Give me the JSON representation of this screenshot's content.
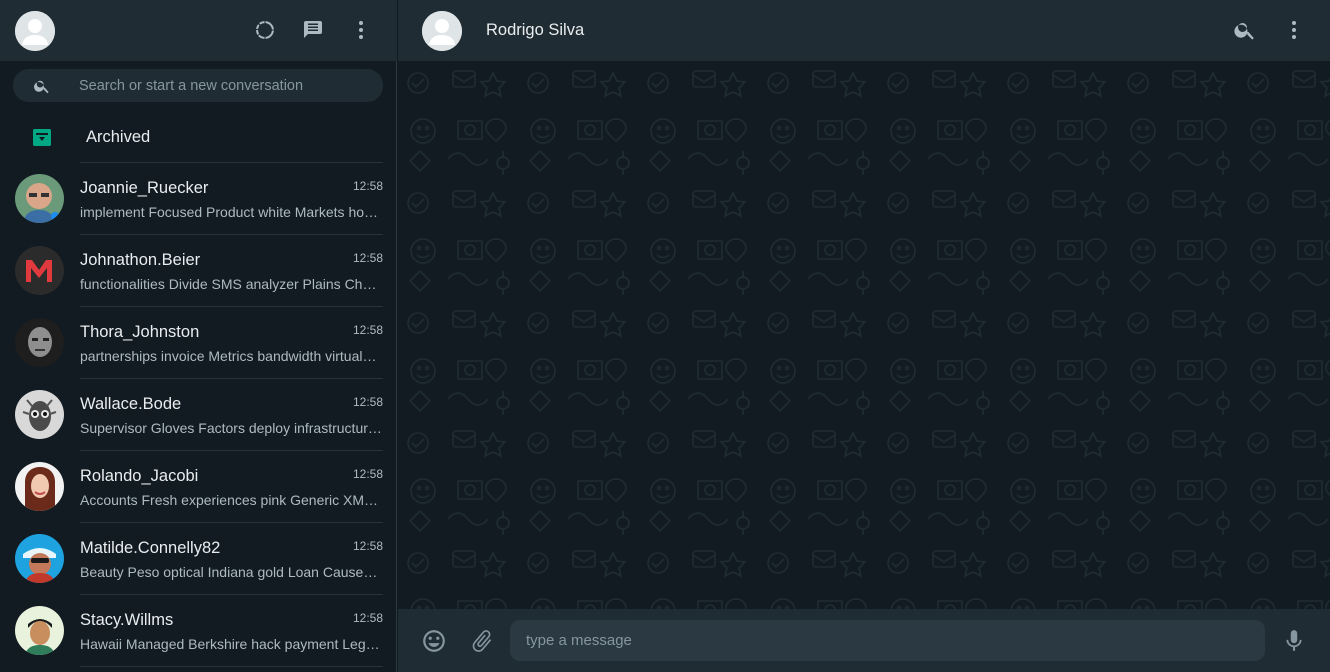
{
  "sidebar": {
    "header": {
      "avatar_icon": "user-silhouette-icon",
      "icons": [
        "status-icon",
        "new-chat-icon",
        "menu-dots-icon"
      ]
    },
    "search": {
      "placeholder": "Search or start a new conversation",
      "icon": "search-icon"
    },
    "archived": {
      "label": "Archived",
      "icon": "archive-icon",
      "icon_color": "#00a884"
    },
    "chats": [
      {
        "name": "Joannie_Ruecker",
        "time": "12:58",
        "message": "implement Focused Product white Markets hos…"
      },
      {
        "name": "Johnathon.Beier",
        "time": "12:58",
        "message": "functionalities Divide SMS analyzer Plains Che…"
      },
      {
        "name": "Thora_Johnston",
        "time": "12:58",
        "message": "partnerships invoice Metrics bandwidth virtual…"
      },
      {
        "name": "Wallace.Bode",
        "time": "12:58",
        "message": "Supervisor Gloves Factors deploy infrastructur…"
      },
      {
        "name": "Rolando_Jacobi",
        "time": "12:58",
        "message": "Accounts Fresh experiences pink Generic XML…"
      },
      {
        "name": "Matilde.Connelly82",
        "time": "12:58",
        "message": "Beauty Peso optical Indiana gold Loan Cause…"
      },
      {
        "name": "Stacy.Willms",
        "time": "12:58",
        "message": "Hawaii Managed Berkshire hack payment Leg…"
      }
    ]
  },
  "conversation": {
    "title": "Rodrigo Silva",
    "header_icons": [
      "search-icon",
      "menu-dots-icon"
    ],
    "footer": {
      "placeholder": "type a message",
      "icons": [
        "emoji-icon",
        "attach-icon",
        "mic-icon"
      ]
    }
  },
  "colors": {
    "panel": "#202c33",
    "background": "#111b21",
    "accent": "#00a884",
    "text_primary": "#e9edef",
    "text_secondary": "#aebac1"
  }
}
